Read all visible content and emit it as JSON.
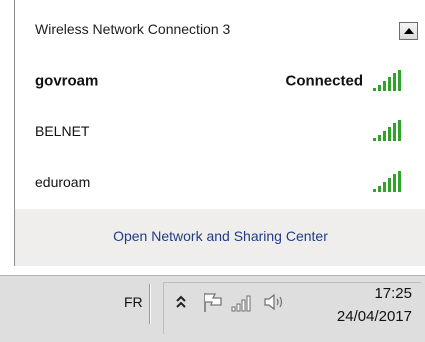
{
  "network_popup": {
    "section_title": "Wireless Network Connection 3",
    "scroll_up_icon": "scroll-up-arrow",
    "networks": [
      {
        "name": "govroam",
        "status": "Connected",
        "signal_icon": "signal-strength-full"
      },
      {
        "name": "BELNET",
        "status": "",
        "signal_icon": "signal-strength-full"
      },
      {
        "name": "eduroam",
        "status": "",
        "signal_icon": "signal-strength-full"
      }
    ],
    "footer_link": "Open Network and Sharing Center"
  },
  "taskbar": {
    "language": "FR",
    "tray_icons": [
      "show-hidden-icons-chevron",
      "action-center-flag-icon",
      "network-signal-icon",
      "volume-icon"
    ],
    "clock": {
      "time": "17:25",
      "date": "24/04/2017"
    }
  },
  "colors": {
    "signal_green": "#2fa428",
    "link_blue": "#1f3c86",
    "footer_bg": "#efeeec",
    "taskbar_bg": "#dedede"
  }
}
